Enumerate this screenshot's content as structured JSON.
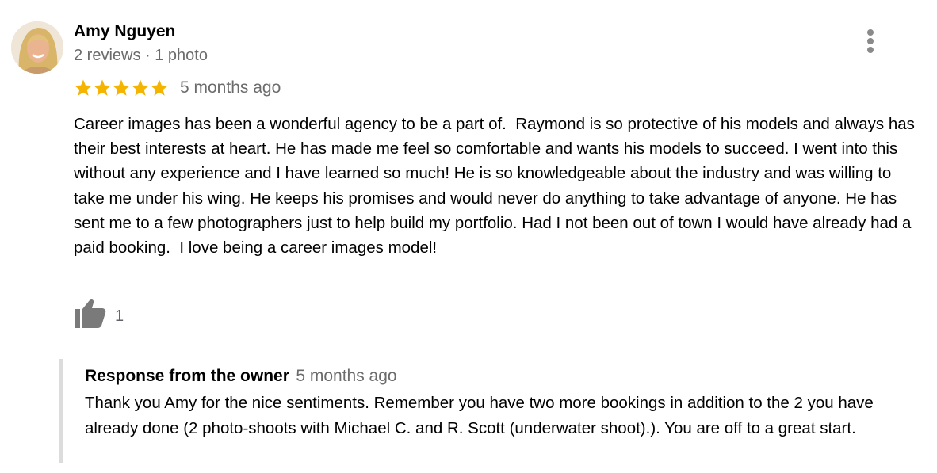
{
  "review": {
    "author_name": "Amy Nguyen",
    "author_meta": "2 reviews · 1 photo",
    "rating": 5,
    "rating_max": 5,
    "date": "5 months ago",
    "text": "Career images has been a wonderful agency to be a part of.  Raymond is so protective of his models and always has their best interests at heart. He has made me feel so comfortable and wants his models to succeed. I went into this without any experience and I have learned so much! He is so knowledgeable about the industry and was willing to take me under his wing. He keeps his promises and would never do anything to take advantage of anyone. He has sent me to a few photographers just to help build my portfolio. Had I not been out of town I would have already had a paid booking.  I love being a career images model!",
    "like_count": "1"
  },
  "owner_response": {
    "label": "Response from the owner",
    "date": "5 months ago",
    "text": "Thank you Amy for the nice sentiments. Remember you have two more bookings in addition to the 2 you have already done (2 photo-shoots with Michael C. and R. Scott (underwater shoot).). You are off to a great start."
  },
  "icons": {
    "more": "more-vert-icon",
    "star": "star-icon",
    "like": "thumbs-up-icon"
  },
  "colors": {
    "star": "#f4b400",
    "meta_text": "#6b6b6b",
    "icon_gray": "#7a7a7a",
    "response_border": "#dcdcdc"
  }
}
